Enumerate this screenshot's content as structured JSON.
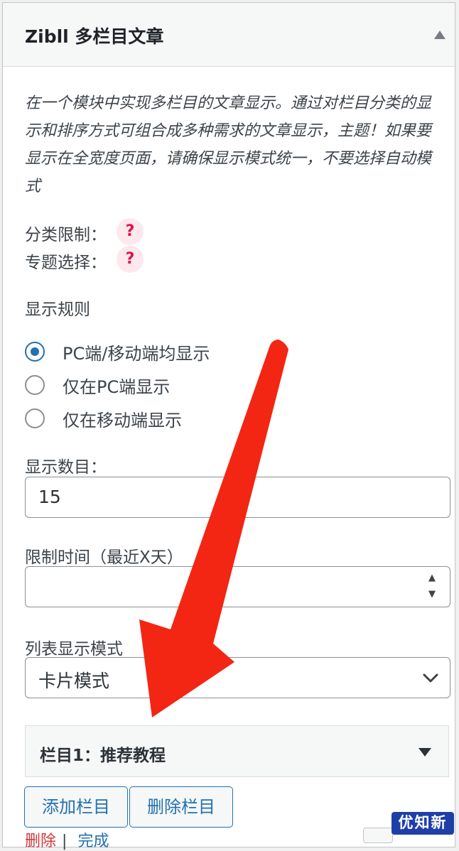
{
  "widget": {
    "title": "Zibll 多栏目文章",
    "description": "在一个模块中实现多栏目的文章显示。通过对栏目分类的显示和排序方式可组合成多种需求的文章显示，主题！如果要显示在全宽度页面，请确保显示模式统一，不要选择自动模式"
  },
  "fields": {
    "category_limit_label": "分类限制：",
    "topic_select_label": "专题选择：",
    "help_glyph": "?",
    "display_rule_label": "显示规则",
    "display_rules": [
      {
        "label": "PC端/移动端均显示",
        "checked": true
      },
      {
        "label": "仅在PC端显示",
        "checked": false
      },
      {
        "label": "仅在移动端显示",
        "checked": false
      }
    ],
    "count_label": "显示数目：",
    "count_value": "15",
    "time_limit_label": "限制时间（最近X天）",
    "time_limit_value": "",
    "list_mode_label": "列表显示模式",
    "list_mode_value": "卡片模式"
  },
  "column": {
    "title": "栏目1：推荐教程"
  },
  "buttons": {
    "add_column": "添加栏目",
    "delete_column": "删除栏目"
  },
  "footer": {
    "delete": "删除",
    "separator": "|",
    "done": "完成"
  },
  "overlay": {
    "arrow_color": "#f22613"
  },
  "watermark": {
    "text": "优知新"
  },
  "colors": {
    "accent": "#2271b1",
    "help": "#e0124e",
    "danger": "#d63638"
  }
}
